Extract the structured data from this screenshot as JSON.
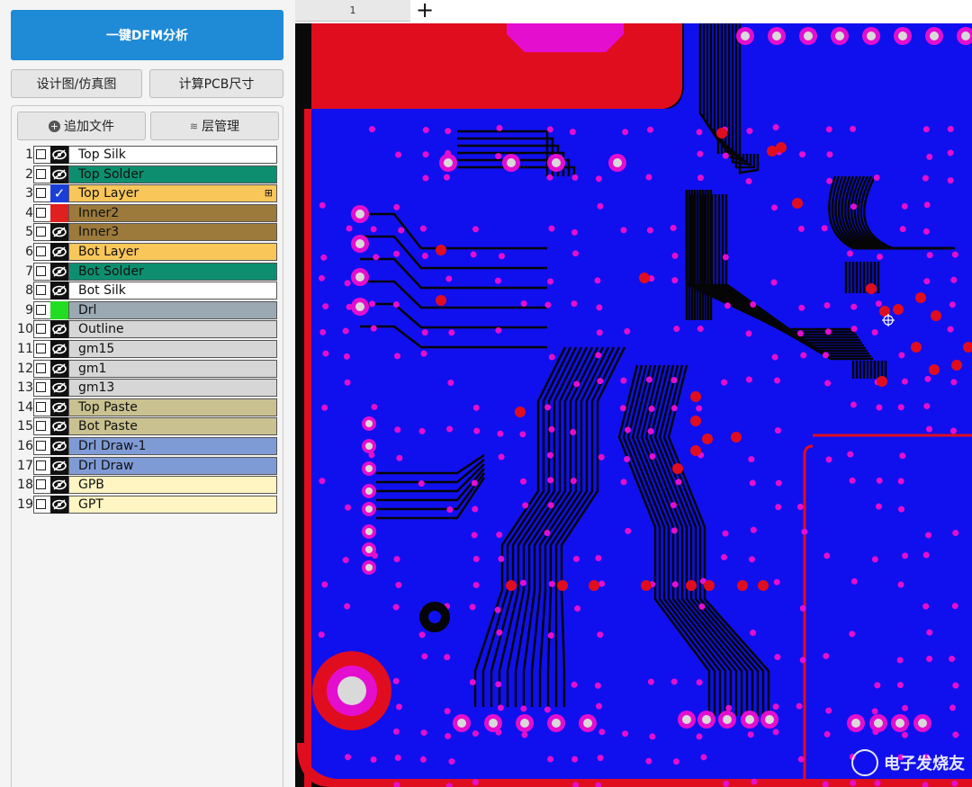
{
  "toolbar": {
    "dfm_button": "一键DFM分析",
    "design_button": "设计图/仿真图",
    "pcb_size_button": "计算PCB尺寸",
    "add_file_button": "追加文件",
    "layer_mgr_button": "层管理"
  },
  "tabs": [
    {
      "label": "1"
    }
  ],
  "layers": [
    {
      "index": "1",
      "name": "Top Silk",
      "color": "#ffffff",
      "checked": false,
      "visible": true
    },
    {
      "index": "2",
      "name": "Top Solder",
      "color": "#0d8f6f",
      "checked": false,
      "visible": true
    },
    {
      "index": "3",
      "name": "Top Layer",
      "color": "#f9c65a",
      "checked": true,
      "visible": true,
      "expand": "⊞"
    },
    {
      "index": "4",
      "name": "Inner2",
      "color": "#9b7a3c",
      "checked": false,
      "swatch": "#e01f1f"
    },
    {
      "index": "5",
      "name": "Inner3",
      "color": "#9b7a3c",
      "checked": false,
      "visible": true
    },
    {
      "index": "6",
      "name": "Bot Layer",
      "color": "#f9c65a",
      "checked": false,
      "visible": true
    },
    {
      "index": "7",
      "name": "Bot Solder",
      "color": "#0d8f6f",
      "checked": false,
      "visible": true
    },
    {
      "index": "8",
      "name": "Bot Silk",
      "color": "#ffffff",
      "checked": false,
      "visible": true
    },
    {
      "index": "9",
      "name": "Drl",
      "color": "#9aa9b2",
      "checked": false,
      "swatch": "#22dd22"
    },
    {
      "index": "10",
      "name": "Outline",
      "color": "#d6d6d6",
      "checked": false,
      "visible": true
    },
    {
      "index": "11",
      "name": "gm15",
      "color": "#d6d6d6",
      "checked": false,
      "visible": true
    },
    {
      "index": "12",
      "name": "gm1",
      "color": "#d6d6d6",
      "checked": false,
      "visible": true
    },
    {
      "index": "13",
      "name": "gm13",
      "color": "#d6d6d6",
      "checked": false,
      "visible": true
    },
    {
      "index": "14",
      "name": "Top Paste",
      "color": "#c9c290",
      "checked": false,
      "visible": true
    },
    {
      "index": "15",
      "name": "Bot Paste",
      "color": "#c9c290",
      "checked": false,
      "visible": true
    },
    {
      "index": "16",
      "name": "Drl Draw-1",
      "color": "#7f9bd6",
      "checked": false,
      "visible": true
    },
    {
      "index": "17",
      "name": "Drl Draw",
      "color": "#7f9bd6",
      "checked": false,
      "visible": true
    },
    {
      "index": "18",
      "name": "GPB",
      "color": "#fff5c2",
      "checked": false,
      "visible": true
    },
    {
      "index": "19",
      "name": "GPT",
      "color": "#fff5c2",
      "checked": false,
      "visible": true
    }
  ],
  "watermark": {
    "text": "电子发烧友"
  }
}
